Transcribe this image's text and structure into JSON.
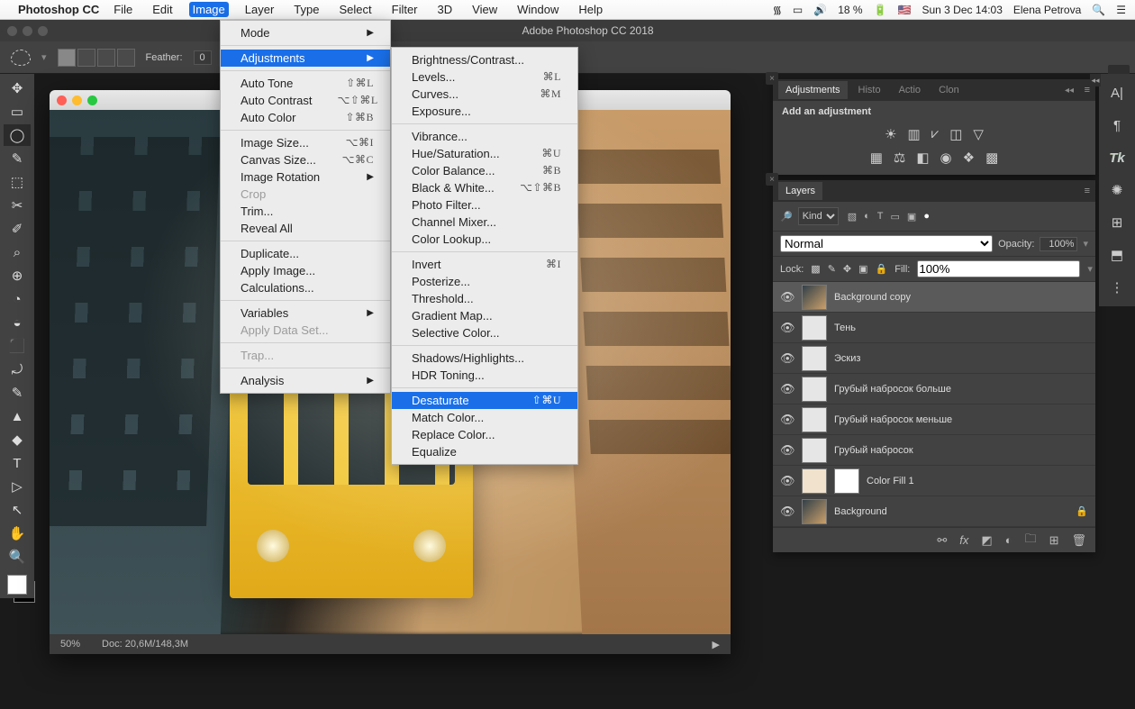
{
  "menubar": {
    "app": "Photoshop CC",
    "items": [
      "File",
      "Edit",
      "Image",
      "Layer",
      "Type",
      "Select",
      "Filter",
      "3D",
      "View",
      "Window",
      "Help"
    ],
    "active": "Image",
    "right": {
      "battery": "18 %",
      "flag": "🇺🇸",
      "datetime": "Sun 3 Dec  14:03",
      "user": "Elena Petrova"
    }
  },
  "app_title": "Adobe Photoshop CC 2018",
  "options_bar": {
    "feather_label": "Feather:",
    "feather_value": "0"
  },
  "doc_status": {
    "zoom": "50%",
    "info": "Doc: 20,6M/148,3M"
  },
  "image_menu": [
    {
      "t": "row",
      "label": "Mode",
      "arrow": true
    },
    {
      "t": "sep"
    },
    {
      "t": "row",
      "label": "Adjustments",
      "arrow": true,
      "hi": true
    },
    {
      "t": "sep"
    },
    {
      "t": "row",
      "label": "Auto Tone",
      "sc": "⇧⌘L"
    },
    {
      "t": "row",
      "label": "Auto Contrast",
      "sc": "⌥⇧⌘L"
    },
    {
      "t": "row",
      "label": "Auto Color",
      "sc": "⇧⌘B"
    },
    {
      "t": "sep"
    },
    {
      "t": "row",
      "label": "Image Size...",
      "sc": "⌥⌘I"
    },
    {
      "t": "row",
      "label": "Canvas Size...",
      "sc": "⌥⌘C"
    },
    {
      "t": "row",
      "label": "Image Rotation",
      "arrow": true
    },
    {
      "t": "row",
      "label": "Crop",
      "dis": true
    },
    {
      "t": "row",
      "label": "Trim..."
    },
    {
      "t": "row",
      "label": "Reveal All"
    },
    {
      "t": "sep"
    },
    {
      "t": "row",
      "label": "Duplicate..."
    },
    {
      "t": "row",
      "label": "Apply Image..."
    },
    {
      "t": "row",
      "label": "Calculations..."
    },
    {
      "t": "sep"
    },
    {
      "t": "row",
      "label": "Variables",
      "arrow": true
    },
    {
      "t": "row",
      "label": "Apply Data Set...",
      "dis": true
    },
    {
      "t": "sep"
    },
    {
      "t": "row",
      "label": "Trap...",
      "dis": true
    },
    {
      "t": "sep"
    },
    {
      "t": "row",
      "label": "Analysis",
      "arrow": true
    }
  ],
  "adjust_menu": [
    {
      "t": "row",
      "label": "Brightness/Contrast..."
    },
    {
      "t": "row",
      "label": "Levels...",
      "sc": "⌘L"
    },
    {
      "t": "row",
      "label": "Curves...",
      "sc": "⌘M"
    },
    {
      "t": "row",
      "label": "Exposure..."
    },
    {
      "t": "sep"
    },
    {
      "t": "row",
      "label": "Vibrance..."
    },
    {
      "t": "row",
      "label": "Hue/Saturation...",
      "sc": "⌘U"
    },
    {
      "t": "row",
      "label": "Color Balance...",
      "sc": "⌘B"
    },
    {
      "t": "row",
      "label": "Black & White...",
      "sc": "⌥⇧⌘B"
    },
    {
      "t": "row",
      "label": "Photo Filter..."
    },
    {
      "t": "row",
      "label": "Channel Mixer..."
    },
    {
      "t": "row",
      "label": "Color Lookup..."
    },
    {
      "t": "sep"
    },
    {
      "t": "row",
      "label": "Invert",
      "sc": "⌘I"
    },
    {
      "t": "row",
      "label": "Posterize..."
    },
    {
      "t": "row",
      "label": "Threshold..."
    },
    {
      "t": "row",
      "label": "Gradient Map..."
    },
    {
      "t": "row",
      "label": "Selective Color..."
    },
    {
      "t": "sep"
    },
    {
      "t": "row",
      "label": "Shadows/Highlights..."
    },
    {
      "t": "row",
      "label": "HDR Toning..."
    },
    {
      "t": "sep"
    },
    {
      "t": "row",
      "label": "Desaturate",
      "sc": "⇧⌘U",
      "hi": true
    },
    {
      "t": "row",
      "label": "Match Color..."
    },
    {
      "t": "row",
      "label": "Replace Color..."
    },
    {
      "t": "row",
      "label": "Equalize"
    }
  ],
  "adjustments_panel": {
    "tabs": [
      "Adjustments",
      "Histo",
      "Actio",
      "Clon"
    ],
    "hint": "Add an adjustment"
  },
  "layers_panel": {
    "title": "Layers",
    "kind_label": "Kind",
    "blend": "Normal",
    "opacity_label": "Opacity:",
    "opacity": "100%",
    "lock_label": "Lock:",
    "fill_label": "Fill:",
    "fill": "100%",
    "layers": [
      {
        "name": "Background copy",
        "sel": true,
        "thumb": "img"
      },
      {
        "name": "Тень",
        "thumb": "sketch"
      },
      {
        "name": "Эскиз",
        "thumb": "sketch"
      },
      {
        "name": "Грубый набросок больше",
        "thumb": "sketch"
      },
      {
        "name": "Грубый набросок меньше",
        "thumb": "sketch"
      },
      {
        "name": "Грубый набросок",
        "thumb": "sketch"
      },
      {
        "name": "Color Fill 1",
        "thumb": "fill",
        "mask": true
      },
      {
        "name": "Background",
        "thumb": "img",
        "locked": true
      }
    ]
  },
  "tools": [
    "✥",
    "▭",
    "◯",
    "✎",
    "⬚",
    "✂",
    "✐",
    "⌕",
    "⊕",
    "◔",
    "◒",
    "⬛",
    "⤾",
    "✎",
    "▲",
    "◆",
    "T",
    "▷",
    "↖",
    "✋",
    "🔍"
  ],
  "right_dock": [
    "A|",
    "¶",
    "Tk",
    "✺",
    "⊞",
    "⬒",
    "⋮"
  ]
}
